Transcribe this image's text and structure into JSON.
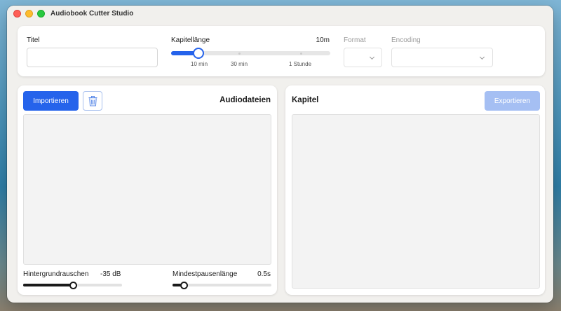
{
  "window": {
    "title": "Audiobook Cutter Studio"
  },
  "settings": {
    "title_label": "Titel",
    "title_value": "",
    "chapter_length_label": "Kapitellänge",
    "chapter_length_value": "10m",
    "chapter_length_position": 0.17,
    "chapter_length_ticks": [
      "10 min",
      "30 min",
      "1 Stunde"
    ],
    "format_label": "Format",
    "format_value": "",
    "encoding_label": "Encoding",
    "encoding_value": ""
  },
  "audio_panel": {
    "import_label": "Importieren",
    "delete_icon": "trash-icon",
    "heading": "Audiodateien",
    "noise_label": "Hintergrundrauschen",
    "noise_value": "-35 dB",
    "noise_position": 0.5,
    "pause_label": "Mindestpausenlänge",
    "pause_value": "0.5s",
    "pause_position": 0.11
  },
  "chapter_panel": {
    "heading": "Kapitel",
    "export_label": "Exportieren"
  },
  "colors": {
    "accent": "#2563eb",
    "accent_disabled": "#a5bff3"
  }
}
